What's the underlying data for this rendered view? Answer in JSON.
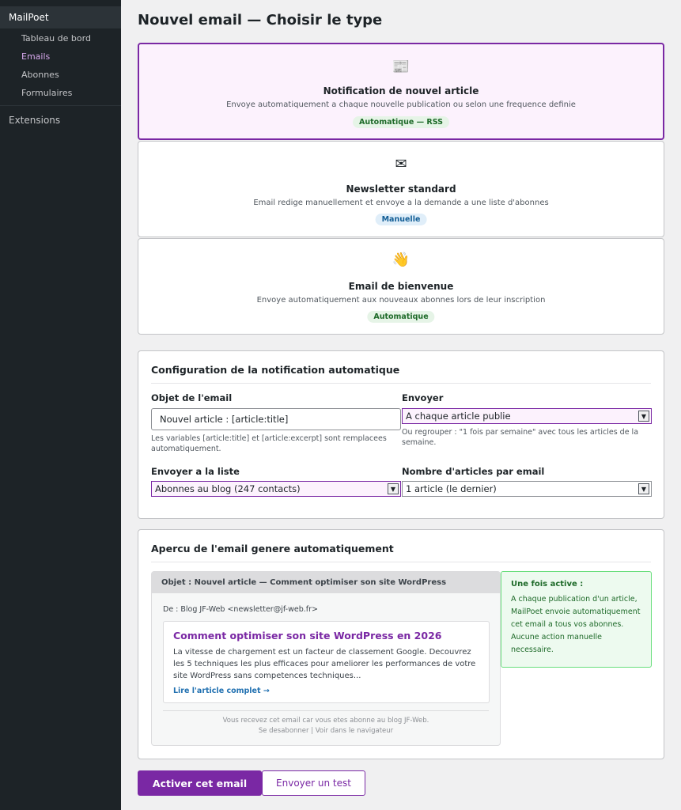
{
  "sidebar": {
    "app": "MailPoet",
    "items": [
      {
        "label": "Tableau de bord"
      },
      {
        "label": "Emails"
      },
      {
        "label": "Abonnes"
      },
      {
        "label": "Formulaires"
      }
    ],
    "extensions": "Extensions"
  },
  "page": {
    "title": "Nouvel email — Choisir le type"
  },
  "types": [
    {
      "icon": "📰",
      "icon_name": "newspaper-icon",
      "title": "Notification de nouvel article",
      "desc": "Envoye automatiquement a chaque nouvelle publication ou selon une frequence definie",
      "badge": "Automatique — RSS",
      "selected": true
    },
    {
      "icon": "✉",
      "icon_name": "envelope-icon",
      "title": "Newsletter standard",
      "desc": "Email redige manuellement et envoye a la demande a une liste d'abonnes",
      "badge": "Manuelle"
    },
    {
      "icon": "👋",
      "icon_name": "waving-hand-icon",
      "title": "Email de bienvenue",
      "desc": "Envoye automatiquement aux nouveaux abonnes lors de leur inscription",
      "badge": "Automatique"
    }
  ],
  "config": {
    "title": "Configuration de la notification automatique",
    "subject_label": "Objet de l'email",
    "subject_value": "Nouvel article : [article:title]",
    "subject_help": "Les variables [article:title] et [article:excerpt] sont remplacees automatiquement.",
    "send_label": "Envoyer",
    "send_value": "A chaque article publie",
    "send_help": "Ou regrouper : \"1 fois par semaine\" avec tous les articles de la semaine.",
    "list_label": "Envoyer a la liste",
    "list_value": "Abonnes au blog (247 contacts)",
    "count_label": "Nombre d'articles par email",
    "count_value": "1 article (le dernier)"
  },
  "preview": {
    "title": "Apercu de l'email genere automatiquement",
    "subject": "Objet : Nouvel article — Comment optimiser son site WordPress",
    "from": "De : Blog JF-Web <newsletter@jf-web.fr>",
    "article_title": "Comment optimiser son site WordPress en 2026",
    "article_excerpt": "La vitesse de chargement est un facteur de classement Google. Decouvrez les 5 techniques les plus efficaces pour ameliorer les performances de votre site WordPress sans competences techniques...",
    "read_more": "Lire l'article complet →",
    "footer_line1": "Vous recevez cet email car vous etes abonne au blog JF-Web.",
    "footer_line2": "Se desabonner | Voir dans le navigateur",
    "info_title": "Une fois active :",
    "info_text": "A chaque publication d'un article, MailPoet envoie automatiquement cet email a tous vos abonnes. Aucune action manuelle necessaire."
  },
  "actions": {
    "activate": "Activer cet email",
    "test": "Envoyer un test"
  },
  "colors": {
    "accent": "#7a28a4",
    "sidebar": "#1d2327",
    "success": "#1e6a29",
    "link": "#2271b1"
  }
}
